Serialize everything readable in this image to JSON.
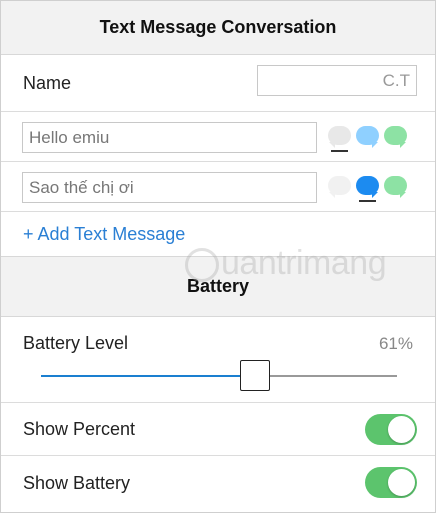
{
  "messages_section": {
    "title": "Text Message Conversation",
    "name_label": "Name",
    "name_value": "C.T",
    "messages": [
      {
        "text": "Hello emiu",
        "selected_style": "grey"
      },
      {
        "text": "Sao thế chị ơi",
        "selected_style": "blue"
      }
    ],
    "add_label": "+ Add Text Message"
  },
  "battery_section": {
    "title": "Battery",
    "level_label": "Battery Level",
    "level_value": "61%",
    "level_fraction": 0.61,
    "show_percent_label": "Show Percent",
    "show_percent_on": true,
    "show_battery_label": "Show Battery",
    "show_battery_on": true
  },
  "colors": {
    "link": "#2a7fd4",
    "slider_fill": "#1a7fd0",
    "toggle_on": "#5cc46d",
    "bubble_grey": "#e8e8e8",
    "bubble_blue": "#8fd0ff",
    "bubble_blue_selected": "#1c8bf0",
    "bubble_green": "#8de2a4"
  },
  "watermark": "uantrimang"
}
